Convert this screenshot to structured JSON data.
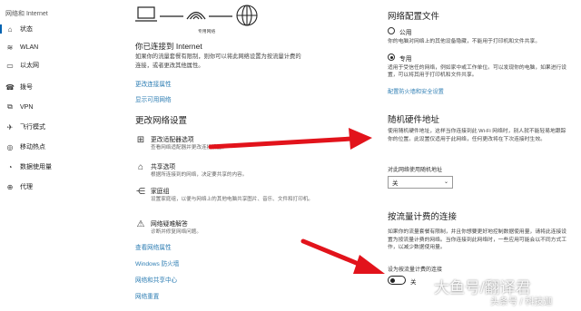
{
  "sidebar": {
    "title": "网络和 Internet",
    "items": [
      {
        "icon": "home-icon",
        "glyph": "⌂",
        "label": "状态"
      },
      {
        "icon": "wifi-icon",
        "glyph": "≋",
        "label": "WLAN"
      },
      {
        "icon": "ethernet-icon",
        "glyph": "▭",
        "label": "以太网"
      },
      {
        "icon": "phone-icon",
        "glyph": "☎",
        "label": "拨号"
      },
      {
        "icon": "vpn-icon",
        "glyph": "⧉",
        "label": "VPN"
      },
      {
        "icon": "airplane-icon",
        "glyph": "✈",
        "label": "飞行模式"
      },
      {
        "icon": "hotspot-icon",
        "glyph": "◎",
        "label": "移动热点"
      },
      {
        "icon": "data-usage-icon",
        "glyph": "◔",
        "label": "数据使用量"
      },
      {
        "icon": "proxy-icon",
        "glyph": "⊕",
        "label": "代理"
      }
    ]
  },
  "status": {
    "network_label": "专用网络",
    "connected_title": "你已连接到 Internet",
    "connected_desc": "如果你的流量套餐有限制，则你可以将此网络设置为按流量计费的连接，或者更改其他属性。",
    "link_change_props": "更改连接属性",
    "link_show_networks": "显示可用网络",
    "change_title": "更改网络设置",
    "options": [
      {
        "icon": "adapter-icon",
        "glyph": "⊞",
        "title": "更改适配器选项",
        "desc": "查看网络适配器并更改连接设置。"
      },
      {
        "icon": "sharing-icon",
        "glyph": "⌂",
        "title": "共享选项",
        "desc": "根据所连接到的网络，决定要共享的内容。"
      },
      {
        "icon": "homegroup-icon",
        "glyph": "⋲",
        "title": "家庭组",
        "desc": "设置家庭组，以便与网络上的其他电脑共享图片、音乐、文件和打印机。"
      },
      {
        "icon": "troubleshoot-icon",
        "glyph": "⚠",
        "title": "网络疑难解答",
        "desc": "诊断并修复网络问题。"
      }
    ],
    "links": [
      "查看网络属性",
      "Windows 防火墙",
      "网络和共享中心",
      "网络重置"
    ]
  },
  "profile": {
    "title": "网络配置文件",
    "public_label": "公用",
    "public_desc": "你的电脑对网络上的其他设备隐藏，不能用于打印机和文件共享。",
    "private_label": "专用",
    "private_desc": "适用于受信任的网络，例如家中或工作单位。可以发现你的电脑，如果进行设置，可以将其用于打印机和文件共享。",
    "selected": "private",
    "firewall_link": "配置防火墙和安全设置"
  },
  "random_hw": {
    "title": "随机硬件地址",
    "desc": "使用随机硬件地址，这样当你连接到此 Wi-Fi 网络时，别人就不能轻易地跟踪你的位置。此设置仅适用于此网络，任何更改将在下次连接时生效。",
    "select_label": "对此网络使用随机地址",
    "select_value": "关"
  },
  "metered": {
    "title": "按流量计费的连接",
    "desc": "如果你的流量套餐有限制，并且你想要更好地控制数据使用量，请将此连接设置为按流量计费的网络。当你连接到此网络时，一些应用可能会以不同方式工作，以减少数据使用量。",
    "toggle_label": "设为按流量计费的连接",
    "toggle_state": "关"
  },
  "watermark": {
    "line1": "大鱼号/翻译君",
    "line2": "头条号 / 科技迦"
  }
}
